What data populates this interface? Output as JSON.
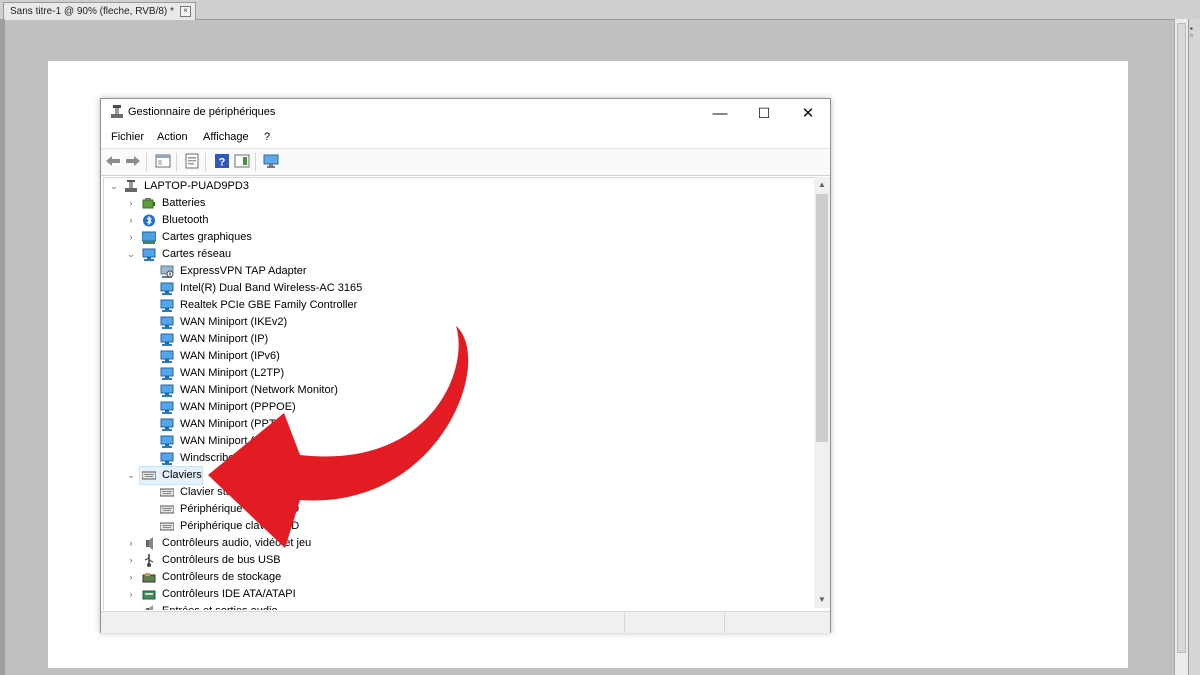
{
  "photoshop": {
    "document_tab": "Sans titre-1 @ 90% (fleche, RVB/8) *",
    "tab_close": "×"
  },
  "window": {
    "title": "Gestionnaire de périphériques",
    "minimize": "—",
    "maximize": "☐",
    "close": "✕"
  },
  "menu": [
    "Fichier",
    "Action",
    "Affichage",
    "?"
  ],
  "toolbar": [
    "back-icon",
    "forward-icon",
    "show-hide-console-tree-icon",
    "properties-icon",
    "help-icon",
    "action-pane-icon",
    "scan-hardware-icon"
  ],
  "tree": {
    "root": "LAPTOP-PUAD9PD3",
    "items": [
      {
        "label": "Batteries",
        "icon": "battery-icon"
      },
      {
        "label": "Bluetooth",
        "icon": "bluetooth-icon"
      },
      {
        "label": "Cartes graphiques",
        "icon": "display-adapter-icon"
      },
      {
        "label": "Cartes réseau",
        "icon": "network-adapter-icon"
      },
      {
        "label": "ExpressVPN TAP Adapter",
        "icon": "network-adapter-warning-icon"
      },
      {
        "label": "Intel(R) Dual Band Wireless-AC 3165",
        "icon": "network-adapter-icon"
      },
      {
        "label": "Realtek PCIe GBE Family Controller",
        "icon": "network-adapter-icon"
      },
      {
        "label": "WAN Miniport (IKEv2)",
        "icon": "network-adapter-icon"
      },
      {
        "label": "WAN Miniport (IP)",
        "icon": "network-adapter-icon"
      },
      {
        "label": "WAN Miniport (IPv6)",
        "icon": "network-adapter-icon"
      },
      {
        "label": "WAN Miniport (L2TP)",
        "icon": "network-adapter-icon"
      },
      {
        "label": "WAN Miniport (Network Monitor)",
        "icon": "network-adapter-icon"
      },
      {
        "label": "WAN Miniport (PPPOE)",
        "icon": "network-adapter-icon"
      },
      {
        "label": "WAN Miniport (PPTP)",
        "icon": "network-adapter-icon"
      },
      {
        "label": "WAN Miniport (SSTP)",
        "icon": "network-adapter-icon"
      },
      {
        "label": "Windscribe VPN",
        "icon": "network-adapter-icon"
      },
      {
        "label": "Claviers",
        "icon": "keyboard-icon"
      },
      {
        "label": "Clavier standard PS/2",
        "icon": "keyboard-icon"
      },
      {
        "label": "Périphérique clavier HID",
        "icon": "keyboard-icon"
      },
      {
        "label": "Périphérique clavier HID",
        "icon": "keyboard-icon"
      },
      {
        "label": "Contrôleurs audio, vidéo et jeu",
        "icon": "speaker-icon"
      },
      {
        "label": "Contrôleurs de bus USB",
        "icon": "usb-icon"
      },
      {
        "label": "Contrôleurs de stockage",
        "icon": "storage-controller-icon"
      },
      {
        "label": "Contrôleurs IDE ATA/ATAPI",
        "icon": "ide-controller-icon"
      },
      {
        "label": "Entrées et sorties audio",
        "icon": "audio-io-icon"
      }
    ]
  },
  "colors": {
    "arrow_red": "#e31b23",
    "selection": "#e5f1fb",
    "network_blue": "#2e8bd6"
  }
}
